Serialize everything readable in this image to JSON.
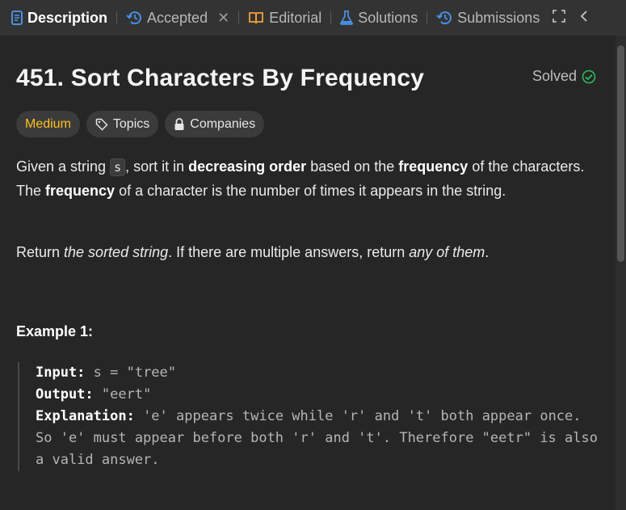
{
  "tabs": [
    {
      "label": "Description",
      "icon": "description-icon",
      "active": true
    },
    {
      "label": "Accepted",
      "icon": "history-icon"
    },
    {
      "label": "Editorial",
      "icon": "book-icon"
    },
    {
      "label": "Solutions",
      "icon": "flask-icon"
    },
    {
      "label": "Submissions",
      "icon": "history-icon"
    }
  ],
  "problem": {
    "title": "451. Sort Characters By Frequency",
    "status": "Solved",
    "difficulty": "Medium",
    "topics_label": "Topics",
    "companies_label": "Companies"
  },
  "description": {
    "p1_a": "Given a string ",
    "p1_code": "s",
    "p1_b": ", sort it in ",
    "p1_bold1": "decreasing order",
    "p1_c": " based on the ",
    "p1_bold2": "frequency",
    "p1_d": " of the characters. The ",
    "p1_bold3": "frequency",
    "p1_e": " of a character is the number of times it appears in the string.",
    "p2_a": "Return ",
    "p2_i1": "the sorted string",
    "p2_b": ". If there are multiple answers, return ",
    "p2_i2": "any of them",
    "p2_c": "."
  },
  "example": {
    "title": "Example 1:",
    "input_label": "Input:",
    "input_value": " s = \"tree\"",
    "output_label": "Output:",
    "output_value": " \"eert\"",
    "explanation_label": "Explanation:",
    "explanation_line1": " 'e' appears twice while 'r' and 't' both appear once.",
    "explanation_line2": "So 'e' must appear before both 'r' and 't'. Therefore \"eetr\" is also a valid answer."
  },
  "colors": {
    "accent_blue": "#4a90e2",
    "medium": "#ffc01e",
    "solved_green": "#2cbb5d"
  }
}
